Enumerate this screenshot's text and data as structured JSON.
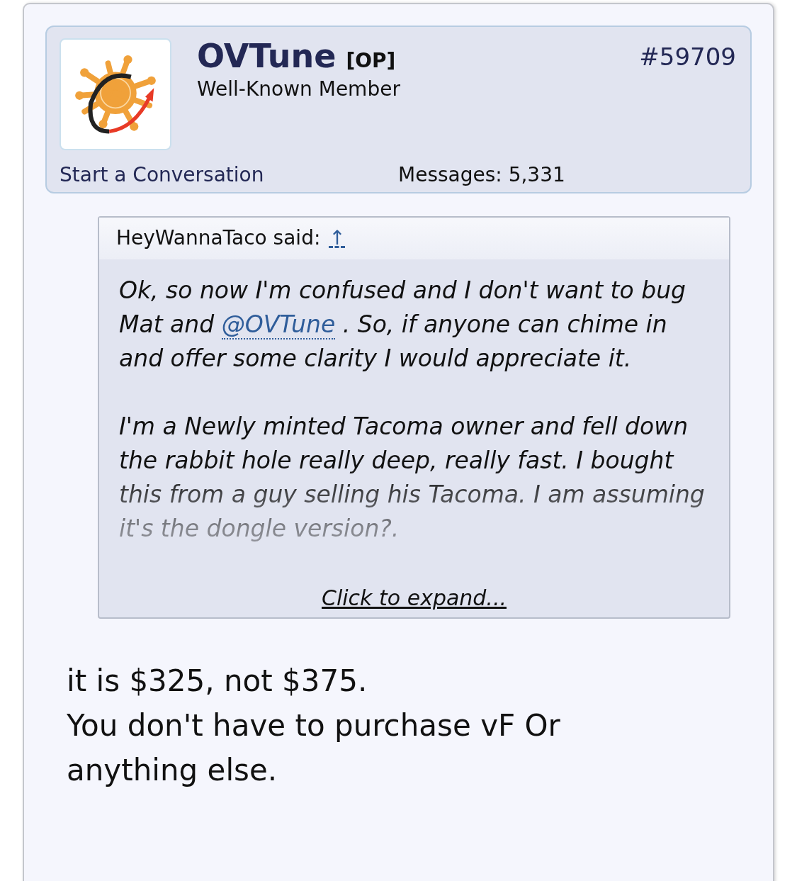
{
  "author": {
    "name": "OVTune",
    "badge": "[OP]",
    "title": "Well-Known Member",
    "post_number": "#59709",
    "conversation_link": "Start a Conversation",
    "messages_label": "Messages:",
    "messages_count": "5,331"
  },
  "quote": {
    "attribution": "HeyWannaTaco said:",
    "jump_icon": "↑",
    "paragraphs": [
      {
        "before": "Ok, so now I'm confused and I don't want to bug Mat and ",
        "mention": "@OVTune",
        "after": " . So, if anyone can chime in and offer some clarity I would appreciate it."
      },
      {
        "before": "I'm a Newly minted Tacoma owner and fell down the rabbit hole really deep, really fast. I bought this from a guy selling his Tacoma. I am assuming it's the dongle version?."
      }
    ],
    "expand_link": "Click to expand..."
  },
  "reply_lines": [
    "it is $325, not $375.",
    "You don't have to purchase vF Or anything else."
  ]
}
